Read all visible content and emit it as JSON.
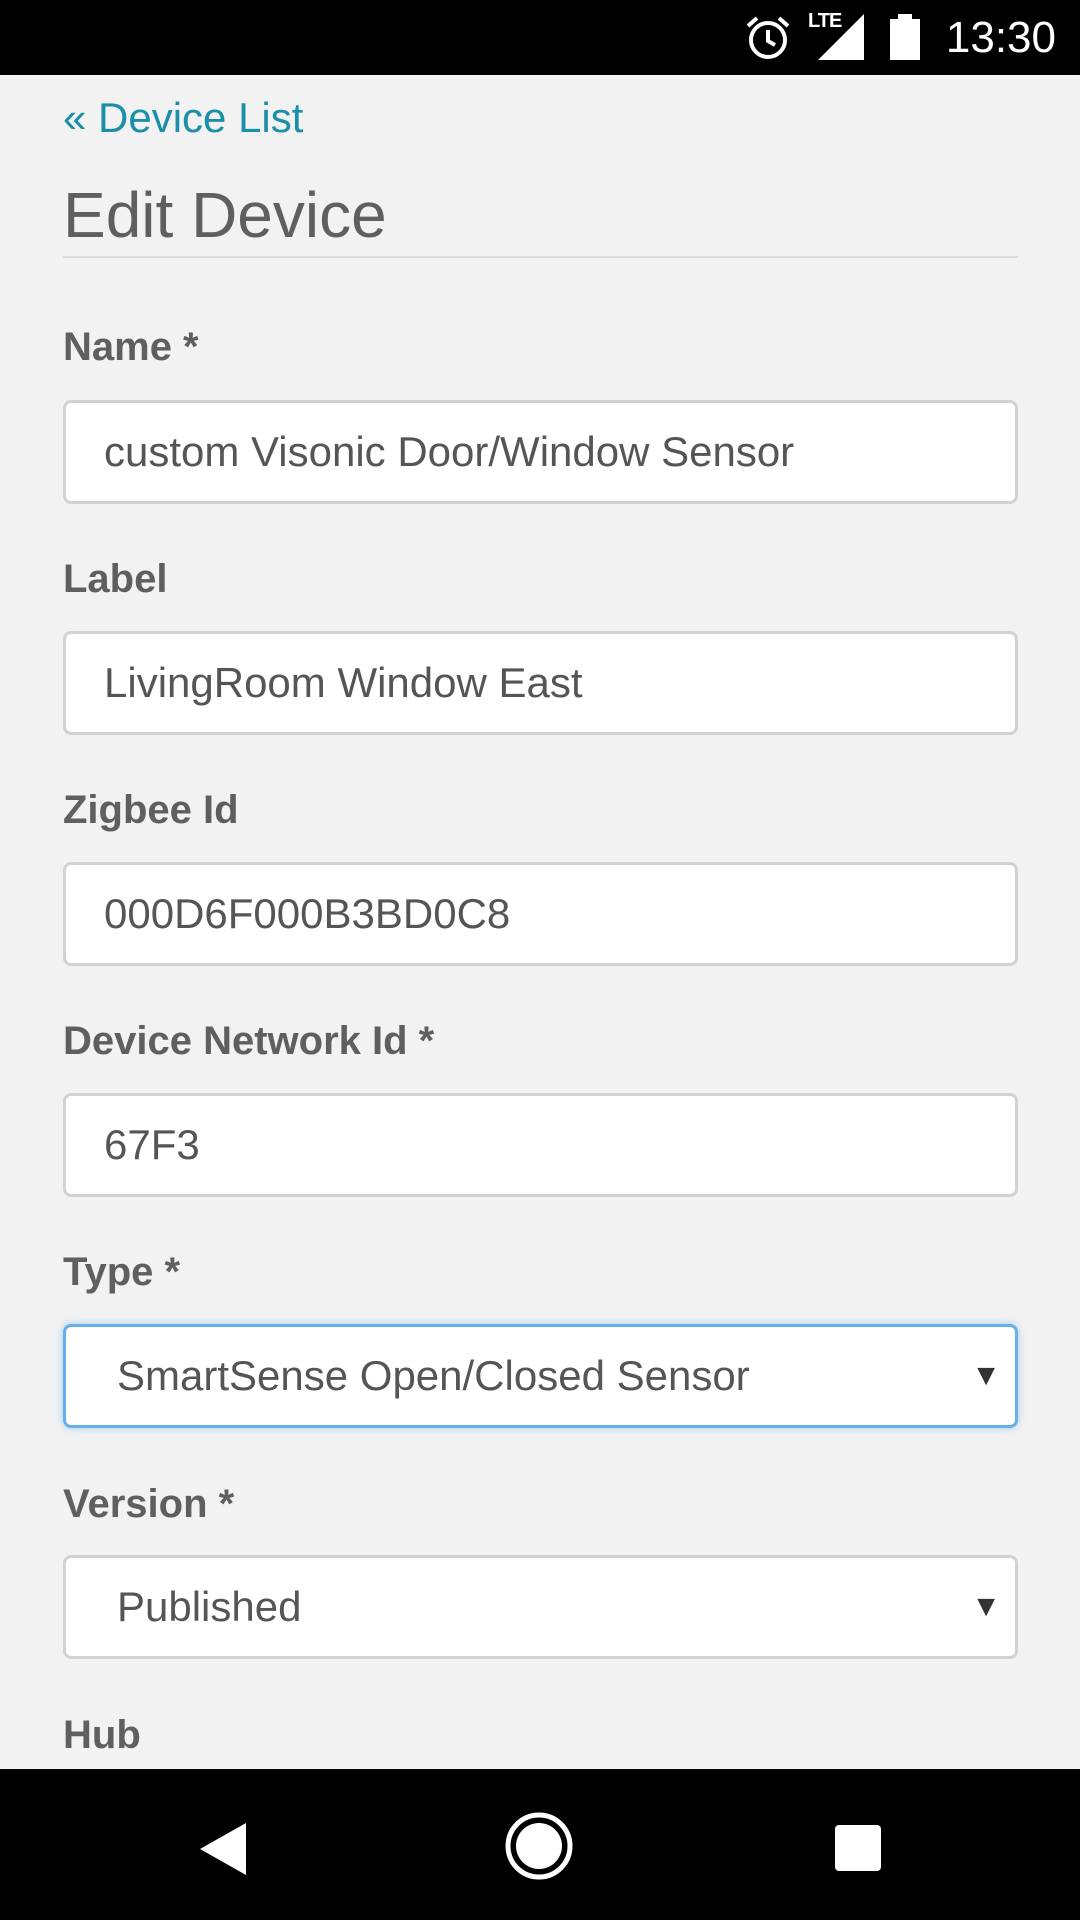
{
  "status_bar": {
    "time": "13:30",
    "network": "LTE",
    "icons": [
      "alarm-icon",
      "signal-icon",
      "battery-icon"
    ]
  },
  "nav": {
    "back_link": "« Device List"
  },
  "page": {
    "title": "Edit Device"
  },
  "form": {
    "name": {
      "label": "Name *",
      "value": "custom Visonic Door/Window Sensor"
    },
    "label": {
      "label": "Label",
      "value": "LivingRoom Window East"
    },
    "zigbee_id": {
      "label": "Zigbee Id",
      "value": "000D6F000B3BD0C8"
    },
    "device_network_id": {
      "label": "Device Network Id *",
      "value": "67F3"
    },
    "type": {
      "label": "Type *",
      "value": "SmartSense Open/Closed Sensor"
    },
    "version": {
      "label": "Version *",
      "value": "Published"
    },
    "hub": {
      "label": "Hub"
    }
  },
  "system_nav": {
    "icons": [
      "back-icon",
      "home-icon",
      "recents-icon"
    ]
  },
  "colors": {
    "link": "#1a8fa8",
    "text": "#5f5f5f",
    "focus_border": "#66afe9",
    "background": "#f2f2f2"
  }
}
